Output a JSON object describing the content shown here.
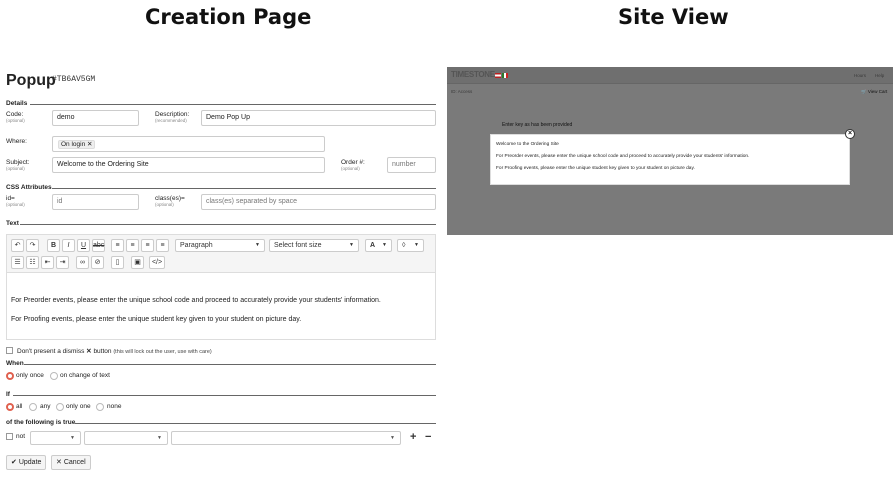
{
  "headings": {
    "creation": "Creation Page",
    "site": "Site View"
  },
  "popup": {
    "title": "Popup",
    "id": "#TB6AV5GM",
    "details": {
      "section": "Details",
      "code_label": "Code:",
      "code_hint": "(optional)",
      "code_value": "demo",
      "description_label": "Description:",
      "description_hint": "(recommended)",
      "description_value": "Demo Pop Up",
      "where_label": "Where:",
      "where_tag": "On login",
      "subject_label": "Subject:",
      "subject_hint": "(optional)",
      "subject_value": "Welcome to the Ordering Site",
      "order_label": "Order #:",
      "order_hint": "(optional)",
      "order_placeholder": "number"
    },
    "css": {
      "section": "CSS Attributes",
      "id_label": "id=",
      "id_hint": "(optional)",
      "id_placeholder": "id",
      "class_label": "class(es)=",
      "class_hint": "(optional)",
      "class_placeholder": "class(es) separated by space"
    },
    "text": {
      "section": "Text",
      "block_format": "Paragraph",
      "font_size": "Select font size",
      "font_color": "A",
      "lines": [
        "For Preorder events, please enter the unique school code and proceed to accurately provide your students' information.",
        "For Proofing events, please enter the unique student key given to your student on picture day."
      ]
    },
    "dismiss": {
      "label": "Don't present a dismiss",
      "button_word": "button",
      "note": "(this will lock out the user, use with care)"
    },
    "when": {
      "section": "When",
      "options": [
        "only once",
        "on change of text"
      ],
      "selected": 0
    },
    "if": {
      "section": "If",
      "options": [
        "all",
        "any",
        "only one",
        "none"
      ],
      "selected": 0
    },
    "following": {
      "section": "of the following is true",
      "not_label": "not",
      "add": "+",
      "remove": "−"
    },
    "buttons": {
      "update": "Update",
      "cancel": "Cancel"
    }
  },
  "site_view": {
    "logo": "TIMESTONE",
    "nav_right": [
      "Hours",
      "Help"
    ],
    "account": "ID: Access",
    "cart": "View Cart",
    "bg_text": "Enter key as has been provided",
    "modal": {
      "title": "Welcome to the Ordering Site",
      "lines": [
        "For Preorder events, please enter the unique school code and proceed to accurately provide your students' information.",
        "For Proofing events, please enter the unique student key given to your student on picture day."
      ],
      "close": "×"
    }
  },
  "colors": {
    "radio_selected": "#e0614f",
    "overlay": "#7a7a7a"
  }
}
